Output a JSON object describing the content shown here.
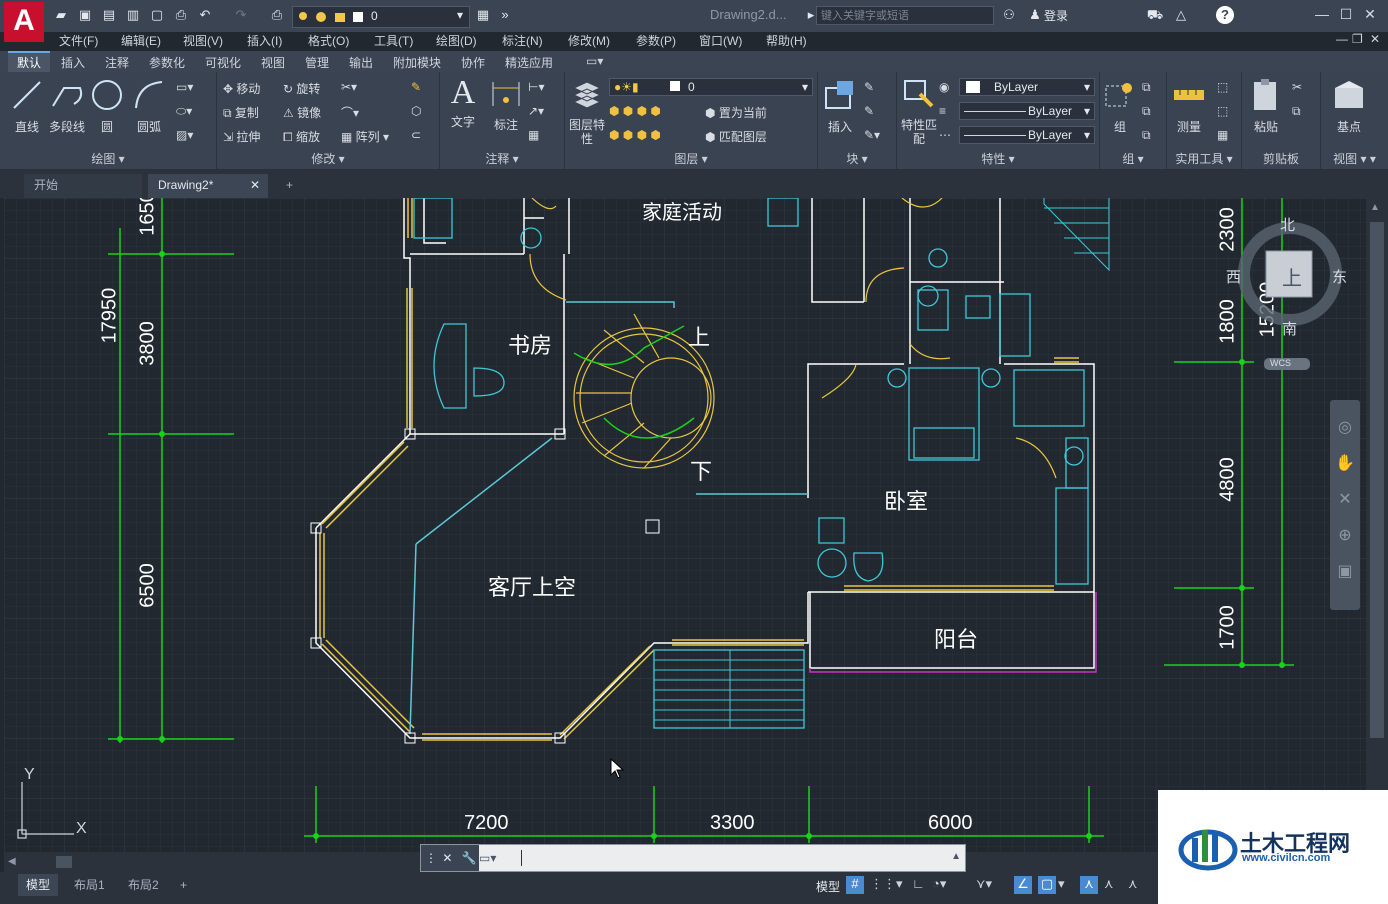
{
  "app": {
    "logo_letter": "A",
    "doc_title": "Drawing2.d...",
    "layer_name": "0",
    "search_placeholder": "键入关键字或短语",
    "login_label": "登录"
  },
  "menu": [
    "文件(F)",
    "编辑(E)",
    "视图(V)",
    "插入(I)",
    "格式(O)",
    "工具(T)",
    "绘图(D)",
    "标注(N)",
    "修改(M)",
    "参数(P)",
    "窗口(W)",
    "帮助(H)"
  ],
  "ribbon_tabs": [
    "默认",
    "插入",
    "注释",
    "参数化",
    "可视化",
    "视图",
    "管理",
    "输出",
    "附加模块",
    "协作",
    "精选应用"
  ],
  "ribbon": {
    "draw": {
      "title": "绘图",
      "line": "直线",
      "polyline": "多段线",
      "circle": "圆",
      "arc": "圆弧"
    },
    "modify": {
      "title": "修改",
      "move": "移动",
      "rotate": "旋转",
      "copy": "复制",
      "mirror": "镜像",
      "stretch": "拉伸",
      "scale": "缩放",
      "array": "阵列"
    },
    "annotation": {
      "title": "注释",
      "text": "文字",
      "dimension": "标注"
    },
    "layers": {
      "title": "图层",
      "props": "图层特性",
      "layer_combo": "0",
      "set_current": "置为当前",
      "match_layer": "匹配图层"
    },
    "block": {
      "title": "块",
      "insert": "插入"
    },
    "properties": {
      "title": "特性",
      "match": "特性匹配",
      "color": "ByLayer",
      "linetype": "ByLayer",
      "lineweight": "ByLayer"
    },
    "group": {
      "title": "组",
      "group": "组"
    },
    "utilities": {
      "title": "实用工具",
      "measure": "测量"
    },
    "clipboard": {
      "title": "剪贴板",
      "paste": "粘贴"
    },
    "view": {
      "title": "视图",
      "base": "基点"
    }
  },
  "doc_tabs": [
    "开始",
    "Drawing2*"
  ],
  "drawing": {
    "rooms": [
      "家庭活动",
      "书房",
      "上",
      "下",
      "卧室",
      "客厅上空",
      "阳台"
    ],
    "dims_left": [
      "17950",
      "1650",
      "3800",
      "6500"
    ],
    "dims_right": [
      "2300",
      "15200",
      "1800",
      "4800",
      "1700"
    ],
    "dims_bottom": [
      "7200",
      "3300",
      "6000"
    ],
    "viewcube": {
      "north": "北",
      "south": "南",
      "east": "东",
      "west": "西",
      "top": "上",
      "wcs": "WCS"
    },
    "ucs": {
      "x": "X",
      "y": "Y"
    }
  },
  "layout_tabs": [
    "模型",
    "布局1",
    "布局2"
  ],
  "status": {
    "model_label": "模型"
  },
  "watermark": {
    "name": "土木工程网",
    "url": "www.civilcn.com"
  }
}
